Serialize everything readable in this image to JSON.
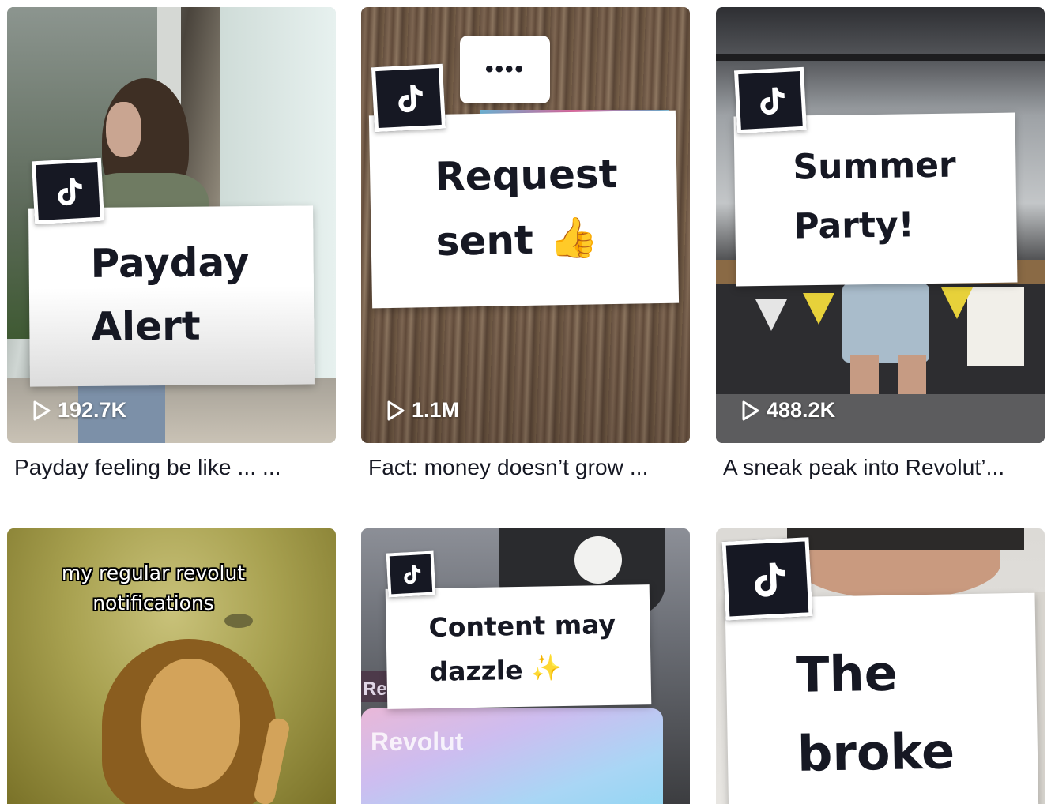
{
  "videos": [
    {
      "views": "192.7K",
      "caption": "Payday feeling be like ... ...",
      "sign_lines": [
        "Payday",
        "Alert"
      ]
    },
    {
      "views": "1.1M",
      "caption": "Fact: money doesn’t grow ...",
      "sign_lines": [
        "Request",
        "sent"
      ],
      "bubble": "••••",
      "emoji": "👍"
    },
    {
      "views": "488.2K",
      "caption": "A sneak peak into Revolut’...",
      "sign_lines": [
        "Summer",
        "Party!"
      ]
    },
    {
      "overlay_lines": [
        "my regular revolut",
        "notifications"
      ]
    },
    {
      "sign_lines": [
        "Content may",
        "dazzle"
      ],
      "emoji": "✨",
      "bg_text": "Revolut",
      "bg_text2": "Re"
    },
    {
      "sign_lines": [
        "The",
        "broke"
      ]
    }
  ],
  "icons": {
    "platform": "tiktok-icon",
    "play": "play-icon"
  },
  "colors": {
    "text": "#161823",
    "accent": "#fe2c55"
  }
}
